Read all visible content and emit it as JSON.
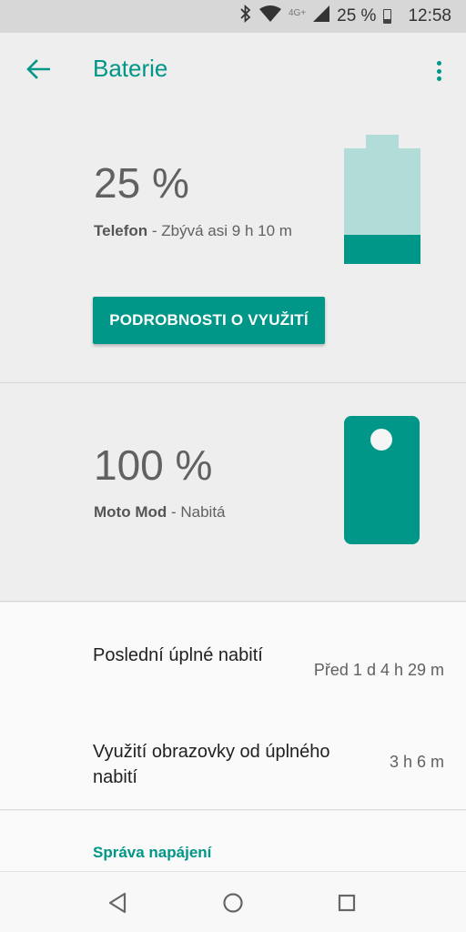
{
  "status_bar": {
    "bluetooth_icon": "bluetooth-icon",
    "wifi_icon": "wifi-icon",
    "network_label": "4G+",
    "signal_icon": "signal-icon",
    "battery_text": "25 %",
    "time": "12:58"
  },
  "app_bar": {
    "back_icon": "arrow-back-icon",
    "title": "Baterie",
    "menu_icon": "more-vert-icon"
  },
  "phone": {
    "percent_text": "25 %",
    "level": 0.25,
    "device": "Telefon",
    "detail": " - Zbývá asi 9 h 10 m",
    "usage_button": "PODROBNOSTI O VYUŽITÍ"
  },
  "moto_mod": {
    "percent_text": "100 %",
    "device": "Moto Mod",
    "detail": " - Nabitá"
  },
  "stats": [
    {
      "label": "Poslední úplné nabití",
      "value": "Před 1 d 4 h 29 m"
    },
    {
      "label": "Využití obrazovky od úplného nabití",
      "value": "3 h 6 m"
    }
  ],
  "power_management": "Správa napájení",
  "nav_bar": {
    "back": "nav-back-icon",
    "home": "nav-home-icon",
    "recents": "nav-recents-icon"
  },
  "colors": {
    "accent": "#009688",
    "accent_light": "#b2dcd8",
    "background": "#eeeeee"
  }
}
